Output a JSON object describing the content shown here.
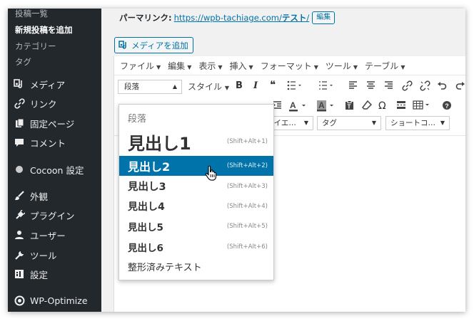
{
  "sidebar": {
    "sub_items": [
      {
        "label": "投稿一覧",
        "current": false
      },
      {
        "label": "新規投稿を追加",
        "current": true
      },
      {
        "label": "カテゴリー",
        "current": false
      },
      {
        "label": "タグ",
        "current": false
      }
    ],
    "menu": [
      {
        "label": "メディア",
        "icon": "media-icon"
      },
      {
        "label": "リンク",
        "icon": "link-icon"
      },
      {
        "label": "固定ページ",
        "icon": "page-icon"
      },
      {
        "label": "コメント",
        "icon": "comment-icon"
      },
      {
        "label": "Cocoon 設定",
        "icon": "cocoon-icon"
      },
      {
        "label": "外観",
        "icon": "brush-icon"
      },
      {
        "label": "プラグイン",
        "icon": "plugin-icon"
      },
      {
        "label": "ユーザー",
        "icon": "user-icon"
      },
      {
        "label": "ツール",
        "icon": "wrench-icon"
      },
      {
        "label": "設定",
        "icon": "settings-icon"
      },
      {
        "label": "WP-Optimize",
        "icon": "wp-optimize-icon"
      }
    ]
  },
  "permalink": {
    "label": "パーマリンク:",
    "url_base": "https://wpb-tachiage.com/",
    "slug": "テスト",
    "trail": "/",
    "edit_label": "編集"
  },
  "media_button": {
    "label": "メディアを追加",
    "icon": "add-media-icon"
  },
  "menubar": [
    "ファイル",
    "編集",
    "表示",
    "挿入",
    "フォーマット",
    "ツール",
    "テーブル"
  ],
  "toolbar": {
    "format_value": "段落",
    "style_label": "スタイル",
    "bold": "B",
    "italic": "I",
    "quote": "❝",
    "omega": "Ω",
    "selects": [
      "リイエ…",
      "タグ",
      "ショートコ…"
    ]
  },
  "format_dropdown": {
    "items": [
      {
        "label": "段落",
        "shortcut": "",
        "size": 13,
        "weight": "normal",
        "muted": true,
        "active": false
      },
      {
        "label": "見出し1",
        "shortcut": "(Shift+Alt+1)",
        "size": 24,
        "weight": "bold",
        "muted": false,
        "active": false
      },
      {
        "label": "見出し2",
        "shortcut": "(Shift+Alt+2)",
        "size": 16,
        "weight": "bold",
        "muted": false,
        "active": true
      },
      {
        "label": "見出し3",
        "shortcut": "(Shift+Alt+3)",
        "size": 14.5,
        "weight": "bold",
        "muted": false,
        "active": false
      },
      {
        "label": "見出し4",
        "shortcut": "(Shift+Alt+4)",
        "size": 14,
        "weight": "bold",
        "muted": false,
        "active": false
      },
      {
        "label": "見出し5",
        "shortcut": "(Shift+Alt+5)",
        "size": 13.5,
        "weight": "bold",
        "muted": false,
        "active": false
      },
      {
        "label": "見出し6",
        "shortcut": "(Shift+Alt+6)",
        "size": 13.5,
        "weight": "bold",
        "muted": false,
        "active": false
      },
      {
        "label": "整形済みテキスト",
        "shortcut": "",
        "size": 13,
        "weight": "normal",
        "muted": false,
        "active": false
      }
    ]
  },
  "colors": {
    "sidebar_bg": "#23282d",
    "accent": "#0073aa",
    "active_item": "#0073aa"
  }
}
